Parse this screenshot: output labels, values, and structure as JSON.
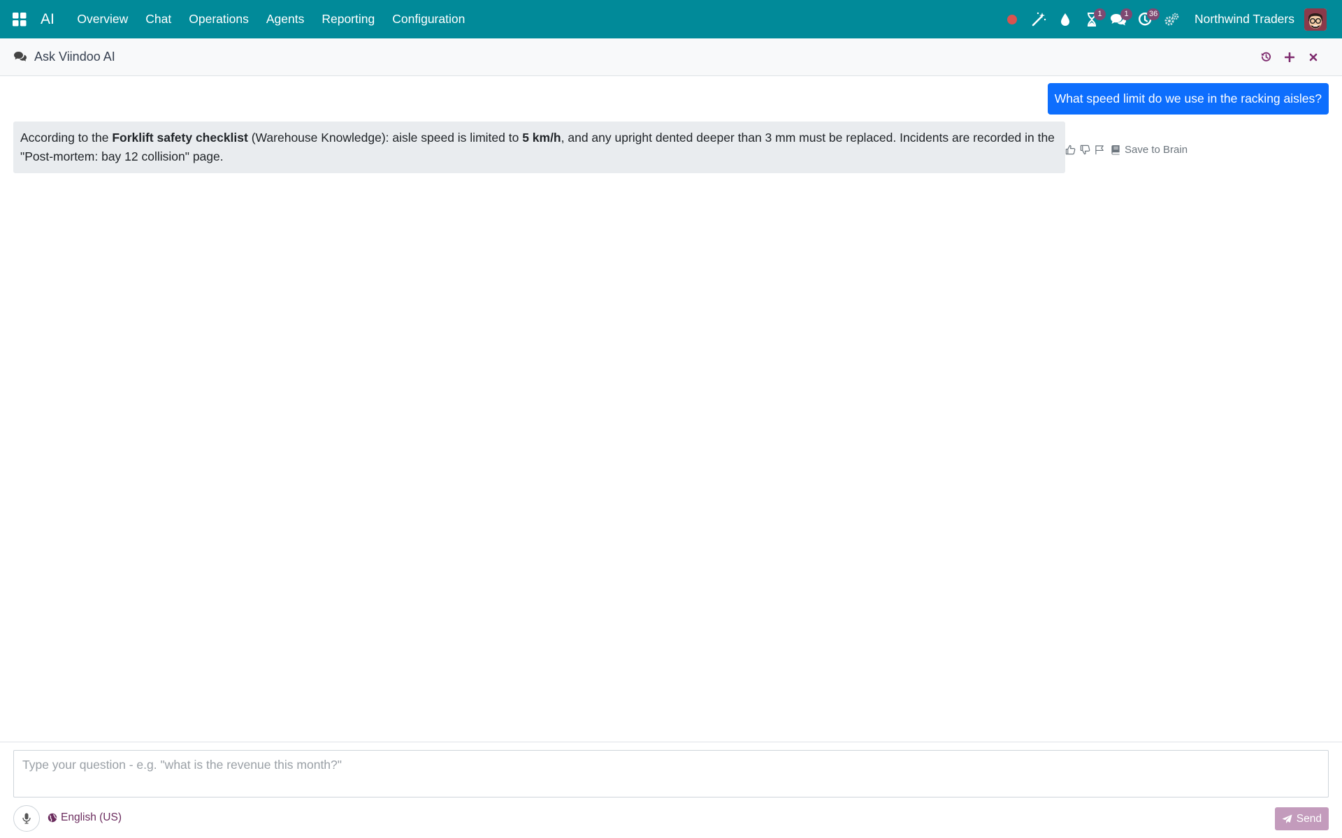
{
  "navbar": {
    "app_name": "AI",
    "menu": [
      "Overview",
      "Chat",
      "Operations",
      "Agents",
      "Reporting",
      "Configuration"
    ],
    "systray": {
      "activities_badge": "1",
      "messages_badge": "1",
      "clock_badge": "36",
      "company": "Northwind Traders"
    },
    "icons": [
      "apps-icon",
      "record-dot-icon",
      "magic-wand-icon",
      "droplet-icon",
      "hourglass-icon",
      "chat-bubbles-icon",
      "clock-icon",
      "gears-icon",
      "user-avatar"
    ]
  },
  "header": {
    "title": "Ask Viindoo AI",
    "actions": [
      "history-icon",
      "plus-icon",
      "close-icon"
    ]
  },
  "conversation": {
    "user_message": "What speed limit do we use in the racking aisles?",
    "ai_message": {
      "p1": "According to the ",
      "b1": "Forklift safety checklist",
      "p2": " (Warehouse Knowledge): aisle speed is limited to ",
      "b2": "5 km/h",
      "p3": ", and any upright dented deeper than 3 mm must be replaced. Incidents are recorded in the \"Post-mortem: bay 12 collision\" page."
    },
    "actions": {
      "save_to_brain": "Save to Brain"
    }
  },
  "composer": {
    "placeholder": "Type your question - e.g. \"what is the revenue this month?\"",
    "language": "English (US)",
    "send_label": "Send"
  },
  "colors": {
    "navbar": "#018a99",
    "user_bubble": "#0d6efd",
    "ai_bubble": "#e9ecef",
    "badge": "#7e4972",
    "send_button": "#c39bbc",
    "accent": "#6b2c5e"
  }
}
